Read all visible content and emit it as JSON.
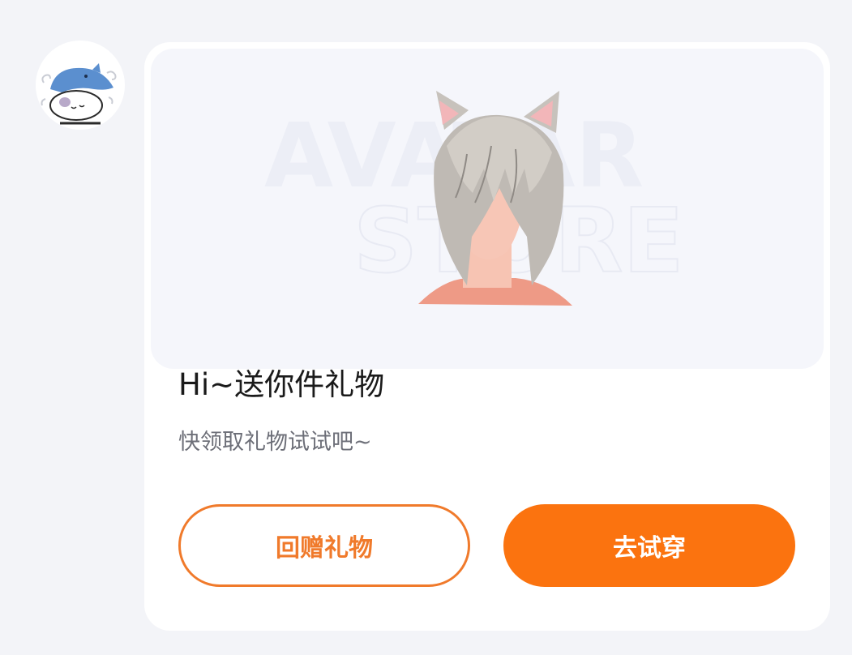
{
  "sender": {
    "avatar_icon": "shark-cat-avatar-icon"
  },
  "gift_card": {
    "banner": {
      "background_text_line1": "AVATAR",
      "background_text_line2": "STORE",
      "illustration_icon": "cat-ear-hair-avatar-icon"
    },
    "title": "Hi~送你件礼物",
    "subtitle": "快领取礼物试试吧~",
    "buttons": {
      "return_gift_label": "回赠礼物",
      "try_on_label": "去试穿"
    }
  },
  "colors": {
    "accent": "#fb730f",
    "accent_outline": "#f07a2b",
    "page_background": "#f3f4f8",
    "card_background": "#ffffff"
  }
}
